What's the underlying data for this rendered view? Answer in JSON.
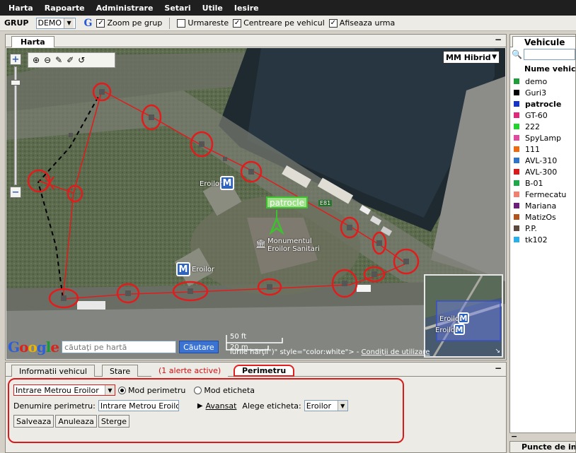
{
  "menu": [
    "Harta",
    "Rapoarte",
    "Administrare",
    "Setari",
    "Utile",
    "Iesire"
  ],
  "toolbar": {
    "group_label": "GRUP",
    "group_value": "DEMO",
    "google_icon": "G",
    "zoom_label": "Zoom pe grup",
    "follow_label": "Urmareste",
    "center_label": "Centreare pe vehicul",
    "trail_label": "Afiseaza urma"
  },
  "map_panel": {
    "tab": "Harta",
    "map_type": "MM Hibrid",
    "labels": {
      "eroilor_1": "Eroilor",
      "eroilor_2": "Eroilor",
      "monument": "Monumentul\nEroilor Sanitari",
      "road": "E81",
      "vehicle": "patrocle",
      "ov_eroilor1": "Eroilor",
      "ov_eroilor2": "Eroilor"
    },
    "search_placeholder": "căutaţi pe hartă",
    "search_button": "Căutare",
    "scale_ft": "50 ft",
    "scale_m": "20 m",
    "copyright_text": "lurile hărţii\")\" style=\"color:white\"> - ",
    "terms_link": "Condiţii de utilizare",
    "google_text": "Google"
  },
  "bottom_panel": {
    "tabs": [
      "Informatii vehicul",
      "Stare",
      "(1 alerte active)",
      "Perimetru"
    ],
    "perimeter_select": "Intrare Metrou Eroilor",
    "mode_perimeter": "Mod perimetru",
    "mode_label": "Mod eticheta",
    "name_label": "Denumire perimetru:",
    "name_value": "Intrare Metrou Eroilor",
    "advanced": "Avansat",
    "choose_label": "Alege eticheta:",
    "label_value": "Eroilor",
    "buttons": [
      "Salveaza",
      "Anuleaza",
      "Sterge"
    ]
  },
  "right_panel": {
    "tab": "Vehicule",
    "column": "Nume vehicul",
    "vehicles": [
      {
        "name": "demo",
        "color": "#1f9d3a",
        "bold": false
      },
      {
        "name": "Guri3",
        "color": "#000000",
        "bold": false
      },
      {
        "name": "patrocle",
        "color": "#1633c8",
        "bold": true
      },
      {
        "name": "GT-60",
        "color": "#e0287a",
        "bold": false
      },
      {
        "name": "222",
        "color": "#22d32e",
        "bold": false
      },
      {
        "name": "SpyLamp",
        "color": "#e04a9e",
        "bold": false
      },
      {
        "name": "111",
        "color": "#ee6a10",
        "bold": false
      },
      {
        "name": "AVL-310",
        "color": "#2e74c8",
        "bold": false
      },
      {
        "name": "AVL-300",
        "color": "#d81a1a",
        "bold": false
      },
      {
        "name": "B-01",
        "color": "#1ea84a",
        "bold": false
      },
      {
        "name": "Fermecatu",
        "color": "#f08070",
        "bold": false
      },
      {
        "name": "Mariana",
        "color": "#6b1f7a",
        "bold": false
      },
      {
        "name": "MatizOs",
        "color": "#b0541e",
        "bold": false
      },
      {
        "name": "P.P.",
        "color": "#5a4a3e",
        "bold": false
      },
      {
        "name": "tk102",
        "color": "#2ab0e8",
        "bold": false
      }
    ],
    "bottom_label": "Puncte de interes"
  }
}
